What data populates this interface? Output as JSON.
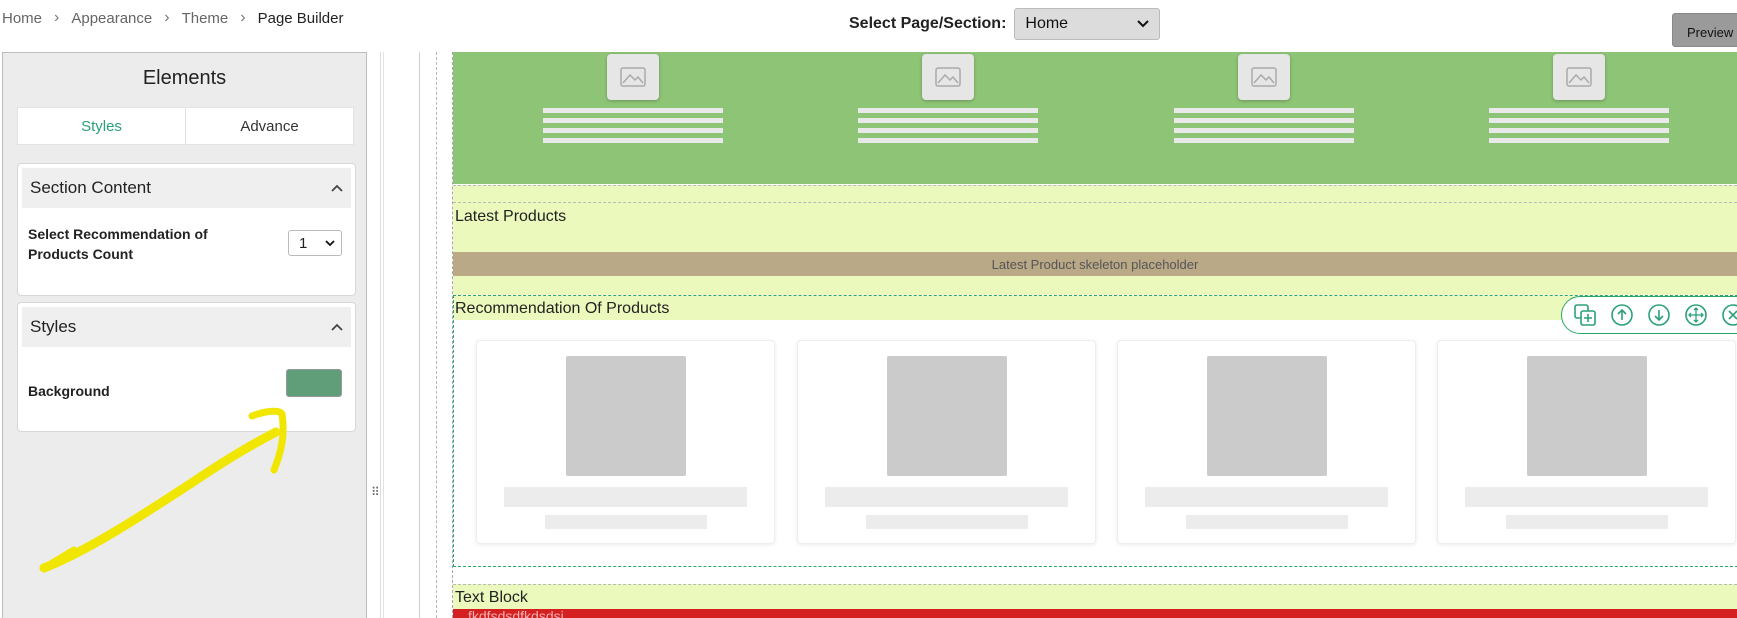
{
  "breadcrumb": {
    "items": [
      "Home",
      "Appearance",
      "Theme",
      "Page Builder"
    ]
  },
  "header": {
    "select_label": "Select Page/Section:",
    "select_value": "Home",
    "preview_label": "Preview"
  },
  "sidebar": {
    "title": "Elements",
    "tabs": [
      "Styles",
      "Advance"
    ],
    "active_tab": "Styles",
    "section_content": {
      "title": "Section Content",
      "field_label": "Select Recommendation of Products Count",
      "field_value": "1"
    },
    "styles": {
      "title": "Styles",
      "background_label": "Background",
      "background_color": "#5f9e78"
    }
  },
  "canvas": {
    "latest_products_title": "Latest Products",
    "latest_placeholder": "Latest Product skeleton placeholder",
    "recommendation_title": "Recommendation Of Products",
    "text_block_title": "Text Block",
    "text_block_preview": "fkdfsdsdfkdsdsi"
  },
  "icons": {
    "toolbar": [
      "duplicate-icon",
      "move-up-icon",
      "move-down-icon",
      "drag-move-icon",
      "close-icon"
    ]
  },
  "colors": {
    "accent": "#2aa17b",
    "hero_bg": "#8ec476",
    "band_bg": "#ebf9bd",
    "skeleton_bar": "#baa987",
    "text_block_bg": "#d42020",
    "annotation": "#f0e600"
  }
}
